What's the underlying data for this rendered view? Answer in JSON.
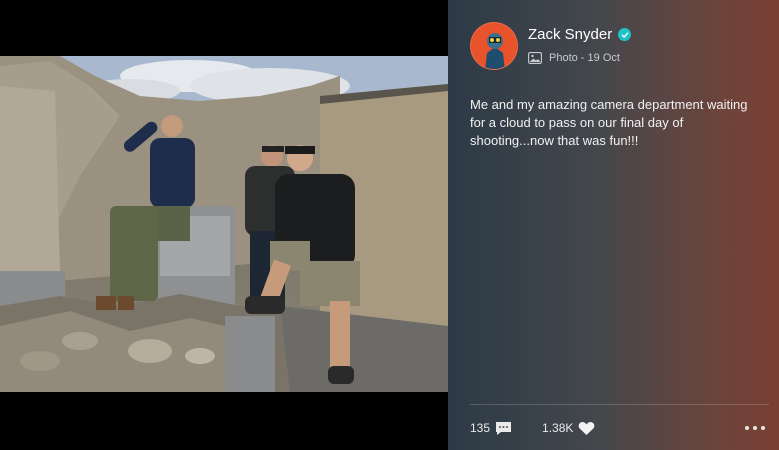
{
  "post": {
    "author_name": "Zack Snyder",
    "verified": true,
    "media_type_label": "Photo",
    "separator": " - ",
    "date": "19 Oct",
    "caption": "Me and my amazing camera department waiting for a cloud to pass on our final day of shooting...now that was fun!!!",
    "comment_count": "135",
    "like_count": "1.38K"
  },
  "colors": {
    "verified_badge": "#1ec3c8",
    "avatar_bg": "#e8532c",
    "panel_gradient_start": "#2c3a46",
    "panel_gradient_end": "#7a3f33"
  },
  "icons": [
    "verified-icon",
    "photo-icon",
    "comment-icon",
    "heart-icon",
    "more-icon"
  ]
}
